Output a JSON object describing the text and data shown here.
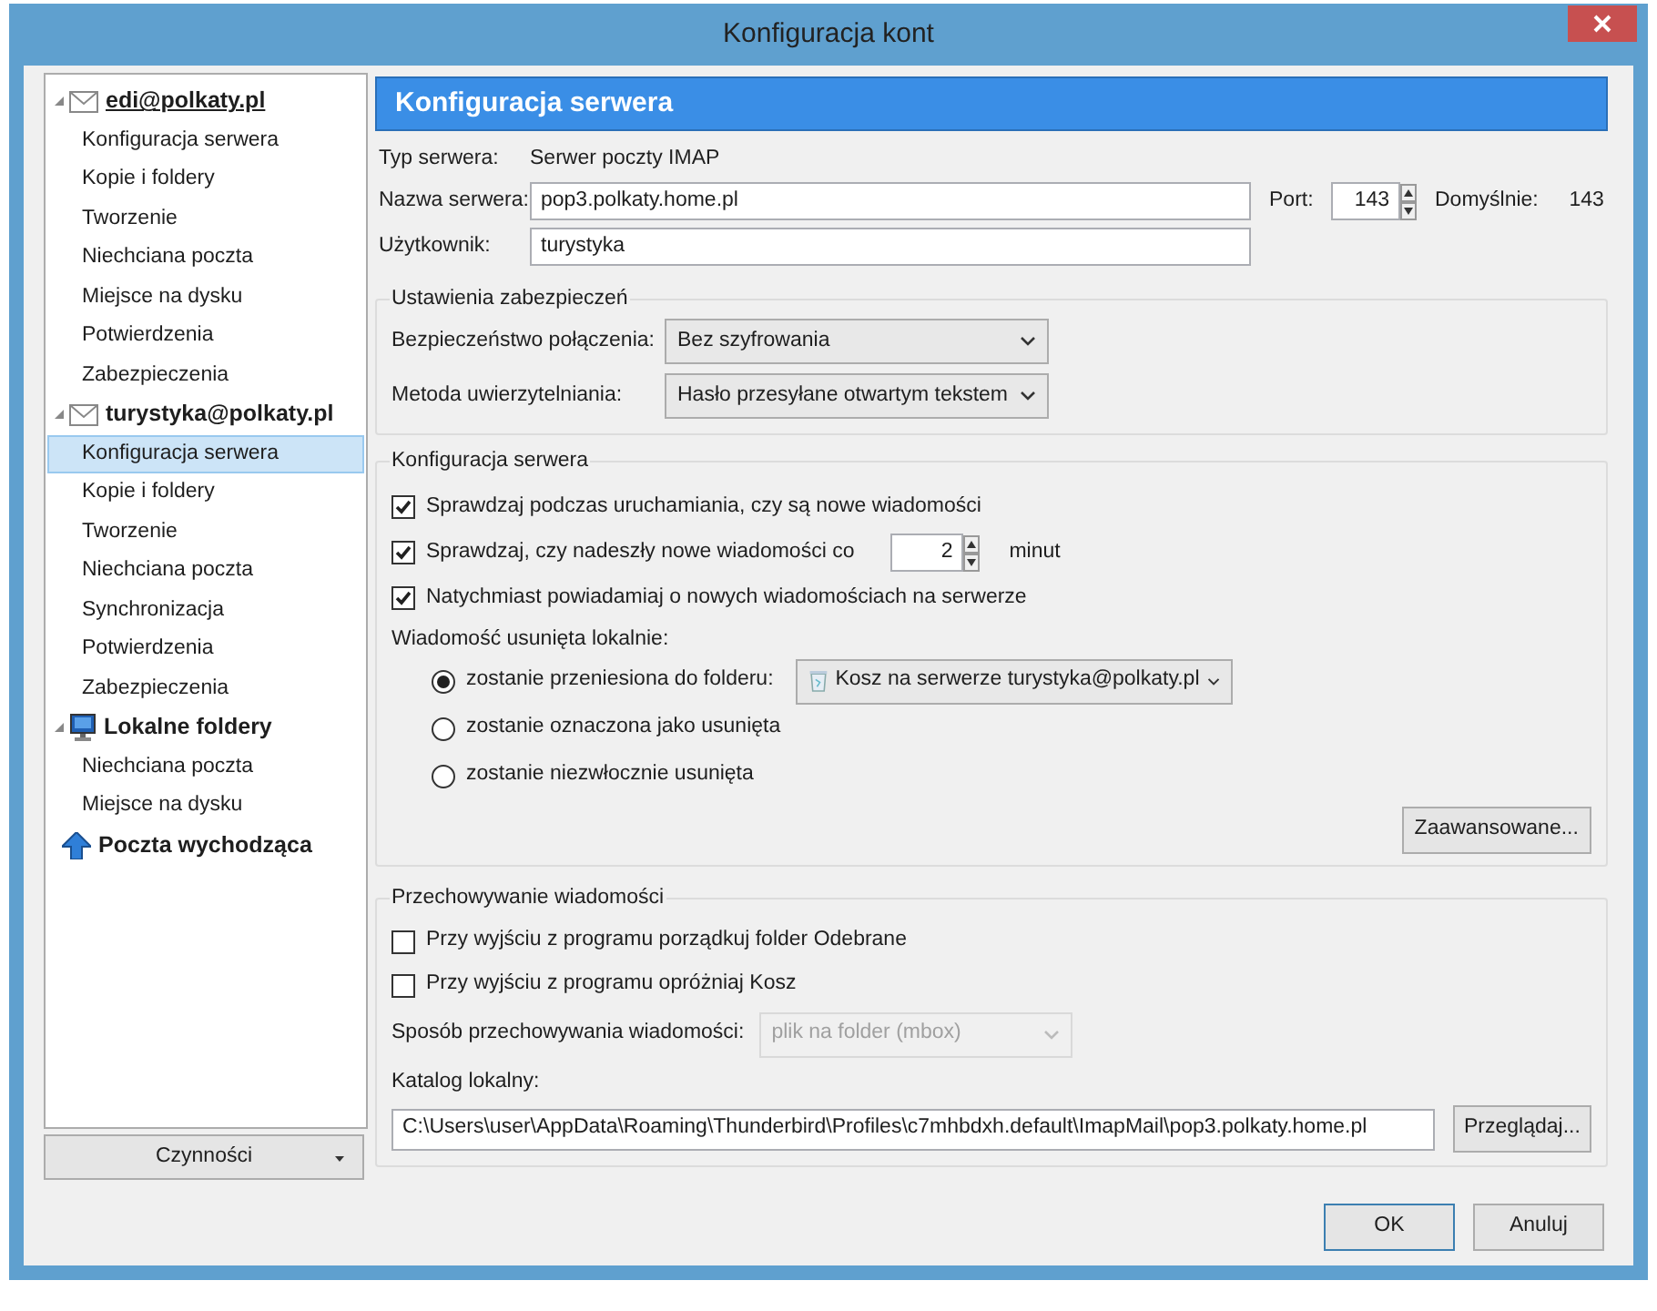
{
  "window": {
    "title": "Konfiguracja kont"
  },
  "sidebar": {
    "accounts": [
      {
        "name": "edi@polkaty.pl",
        "kind": "mail",
        "expanded": true,
        "hovered": true,
        "children": [
          {
            "label": "Konfiguracja serwera",
            "selected": false
          },
          {
            "label": "Kopie i foldery",
            "selected": false
          },
          {
            "label": "Tworzenie",
            "selected": false
          },
          {
            "label": "Niechciana poczta",
            "selected": false
          },
          {
            "label": "Miejsce na dysku",
            "selected": false
          },
          {
            "label": "Potwierdzenia",
            "selected": false
          },
          {
            "label": "Zabezpieczenia",
            "selected": false
          }
        ]
      },
      {
        "name": "turystyka@polkaty.pl",
        "kind": "mail",
        "expanded": true,
        "hovered": false,
        "children": [
          {
            "label": "Konfiguracja serwera",
            "selected": true
          },
          {
            "label": "Kopie i foldery",
            "selected": false
          },
          {
            "label": "Tworzenie",
            "selected": false
          },
          {
            "label": "Niechciana poczta",
            "selected": false
          },
          {
            "label": "Synchronizacja",
            "selected": false
          },
          {
            "label": "Potwierdzenia",
            "selected": false
          },
          {
            "label": "Zabezpieczenia",
            "selected": false
          }
        ]
      },
      {
        "name": "Lokalne foldery",
        "kind": "local",
        "expanded": true,
        "hovered": false,
        "children": [
          {
            "label": "Niechciana poczta",
            "selected": false
          },
          {
            "label": "Miejsce na dysku",
            "selected": false
          }
        ]
      },
      {
        "name": "Poczta wychodząca",
        "kind": "outgoing",
        "hovered": false
      }
    ],
    "actions_button": "Czynności"
  },
  "panel_title": "Konfiguracja serwera",
  "server_type": {
    "label": "Typ serwera:",
    "value": "Serwer poczty IMAP"
  },
  "server_name": {
    "label": "Nazwa serwera:",
    "value": "pop3.polkaty.home.pl"
  },
  "port": {
    "label": "Port:",
    "value": "143",
    "default_label": "Domyślnie:",
    "default_value": "143"
  },
  "user": {
    "label": "Użytkownik:",
    "value": "turystyka"
  },
  "security": {
    "title": "Ustawienia zabezpieczeń",
    "rows": [
      {
        "label": "Bezpieczeństwo połączenia:",
        "value": "Bez szyfrowania"
      },
      {
        "label": "Metoda uwierzytelniania:",
        "value": "Hasło przesyłane otwartym tekstem"
      }
    ]
  },
  "server_settings": {
    "title": "Konfiguracja serwera",
    "options": [
      {
        "kind": "checkbox",
        "label": "Sprawdzaj podczas uruchamiania, czy są nowe wiadomości",
        "checked": true
      },
      {
        "kind": "interval",
        "label": "Sprawdzaj, czy nadeszły nowe wiadomości co",
        "value": "2",
        "unit": "minut",
        "checked": true
      },
      {
        "kind": "checkbox",
        "label": "Natychmiast powiadamiaj o nowych wiadomościach na serwerze",
        "checked": true
      }
    ],
    "delete_label": "Wiadomość usunięta lokalnie:",
    "delete_options": [
      {
        "label": "zostanie przeniesiona do folderu:",
        "selected": true,
        "folder": "Kosz na serwerze turystyka@polkaty.pl"
      },
      {
        "label": "zostanie oznaczona jako usunięta",
        "selected": false
      },
      {
        "label": "zostanie niezwłocznie usunięta",
        "selected": false
      }
    ],
    "advanced_button": "Zaawansowane..."
  },
  "storage": {
    "title": "Przechowywanie wiadomości",
    "options": [
      {
        "label": "Przy wyjściu z programu porządkuj folder Odebrane",
        "checked": false
      },
      {
        "label": "Przy wyjściu z programu opróżniaj Kosz",
        "checked": false
      }
    ],
    "store_type": {
      "label": "Sposób przechowywania wiadomości:",
      "value": "plik na folder (mbox)",
      "disabled": true
    },
    "local_dir_label": "Katalog lokalny:",
    "local_dir": "C:\\Users\\user\\AppData\\Roaming\\Thunderbird\\Profiles\\c7mhbdxh.default\\ImapMail\\pop3.polkaty.home.pl",
    "browse_button": "Przeglądaj..."
  },
  "buttons": [
    {
      "label": "OK",
      "default": true
    },
    {
      "label": "Anuluj",
      "default": false
    }
  ]
}
